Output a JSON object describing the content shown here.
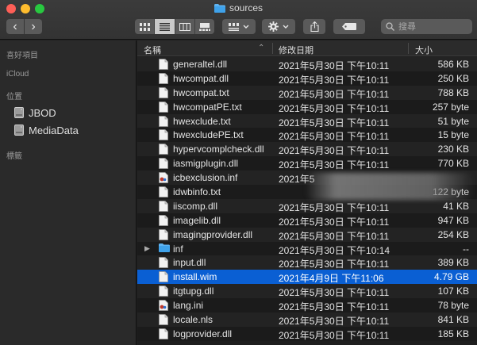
{
  "window": {
    "title": "sources"
  },
  "toolbar": {
    "back_glyph": "‹",
    "forward_glyph": "›",
    "search_placeholder": "搜尋",
    "icons": [
      "icon-view-icon",
      "list-view-icon",
      "column-view-icon",
      "gallery-view-icon",
      "group-icon",
      "action-gear-icon",
      "share-icon",
      "tag-icon",
      "search-icon"
    ],
    "view_selected": "list"
  },
  "sidebar": {
    "sections": {
      "favorites": "喜好項目",
      "icloud": "iCloud",
      "locations": "位置",
      "tags": "標籤"
    },
    "locations": [
      {
        "label": "JBOD",
        "icon": "disk-icon"
      },
      {
        "label": "MediaData",
        "icon": "disk-icon"
      }
    ]
  },
  "columns": {
    "name": "名稱",
    "date": "修改日期",
    "size": "大小",
    "sort_glyph": "⌃"
  },
  "files": [
    {
      "name": "generaltel.dll",
      "date": "2021年5月30日 下午10:11",
      "size": "586 KB",
      "icon": "file-icon"
    },
    {
      "name": "hwcompat.dll",
      "date": "2021年5月30日 下午10:11",
      "size": "250 KB",
      "icon": "file-icon"
    },
    {
      "name": "hwcompat.txt",
      "date": "2021年5月30日 下午10:11",
      "size": "788 KB",
      "icon": "file-icon"
    },
    {
      "name": "hwcompatPE.txt",
      "date": "2021年5月30日 下午10:11",
      "size": "257 byte",
      "icon": "file-icon"
    },
    {
      "name": "hwexclude.txt",
      "date": "2021年5月30日 下午10:11",
      "size": "51 byte",
      "icon": "file-icon"
    },
    {
      "name": "hwexcludePE.txt",
      "date": "2021年5月30日 下午10:11",
      "size": "15 byte",
      "icon": "file-icon"
    },
    {
      "name": "hypervcomplcheck.dll",
      "date": "2021年5月30日 下午10:11",
      "size": "230 KB",
      "icon": "file-icon"
    },
    {
      "name": "iasmigplugin.dll",
      "date": "2021年5月30日 下午10:11",
      "size": "770 KB",
      "icon": "file-icon"
    },
    {
      "name": "icbexclusion.inf",
      "date": "2021年5",
      "size": "",
      "icon": "settings-file-icon"
    },
    {
      "name": "idwbinfo.txt",
      "date": "",
      "size": "122 byte",
      "icon": "file-icon"
    },
    {
      "name": "iiscomp.dll",
      "date": "2021年5月30日 下午10:11",
      "size": "41 KB",
      "icon": "file-icon"
    },
    {
      "name": "imagelib.dll",
      "date": "2021年5月30日 下午10:11",
      "size": "947 KB",
      "icon": "file-icon"
    },
    {
      "name": "imagingprovider.dll",
      "date": "2021年5月30日 下午10:11",
      "size": "254 KB",
      "icon": "file-icon"
    },
    {
      "name": "inf",
      "date": "2021年5月30日 下午10:14",
      "size": "--",
      "icon": "folder-icon",
      "folder": true
    },
    {
      "name": "input.dll",
      "date": "2021年5月30日 下午10:11",
      "size": "389 KB",
      "icon": "file-icon"
    },
    {
      "name": "install.wim",
      "date": "2021年4月9日 下午11:06",
      "size": "4.79 GB",
      "icon": "file-icon",
      "selected": true
    },
    {
      "name": "itgtupg.dll",
      "date": "2021年5月30日 下午10:11",
      "size": "107 KB",
      "icon": "file-icon"
    },
    {
      "name": "lang.ini",
      "date": "2021年5月30日 下午10:11",
      "size": "78 byte",
      "icon": "settings-file-icon"
    },
    {
      "name": "locale.nls",
      "date": "2021年5月30日 下午10:11",
      "size": "841 KB",
      "icon": "file-icon"
    },
    {
      "name": "logprovider.dll",
      "date": "2021年5月30日 下午10:11",
      "size": "185 KB",
      "icon": "file-icon"
    }
  ]
}
